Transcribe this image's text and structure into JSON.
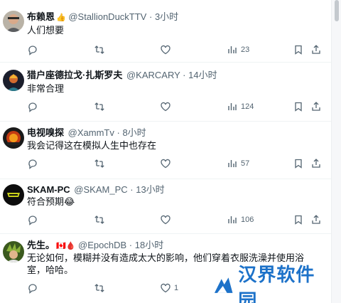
{
  "tweets": [
    {
      "name": "布赖恩",
      "badge": "👍",
      "handle": "@StallionDuckTTV",
      "dot": "·",
      "time": "3小时",
      "text": "人们想要",
      "stats": {
        "reply": "",
        "retweet": "",
        "like": "",
        "views": "23"
      }
    },
    {
      "name": "猎户座德拉戈·扎斯罗夫",
      "badge": "",
      "handle": "@KARCARY",
      "dot": "·",
      "time": "14小时",
      "text": "非常合理",
      "stats": {
        "reply": "",
        "retweet": "",
        "like": "",
        "views": "124"
      }
    },
    {
      "name": "电视嗅探",
      "badge": "",
      "handle": "@XammTv",
      "dot": "·",
      "time": "8小时",
      "text": "我会记得这在模拟人生中也存在",
      "stats": {
        "reply": "",
        "retweet": "",
        "like": "",
        "views": "57"
      }
    },
    {
      "name": "SKAM-PC",
      "badge": "",
      "handle": "@SKAM_PC",
      "dot": "·",
      "time": "13小时",
      "text": "符合预期😂",
      "stats": {
        "reply": "",
        "retweet": "",
        "like": "",
        "views": "106"
      }
    },
    {
      "name": "先生。",
      "badge": "🇨🇦🩸",
      "handle": "@EpochDB",
      "dot": "·",
      "time": "18小时",
      "text": "无论如何，模糊并没有造成太大的影响，他们穿着衣服洗澡并使用浴室，哈哈。",
      "stats": {
        "reply": "",
        "retweet": "",
        "like": "1",
        "views": ""
      }
    }
  ],
  "watermark": {
    "text": "汉界软件园"
  },
  "colors": {
    "muted": "#536471",
    "text": "#0f1419",
    "watermark": "#1d72c9"
  },
  "icons": [
    "reply-icon",
    "retweet-icon",
    "like-icon",
    "views-icon",
    "bookmark-icon",
    "share-icon"
  ]
}
